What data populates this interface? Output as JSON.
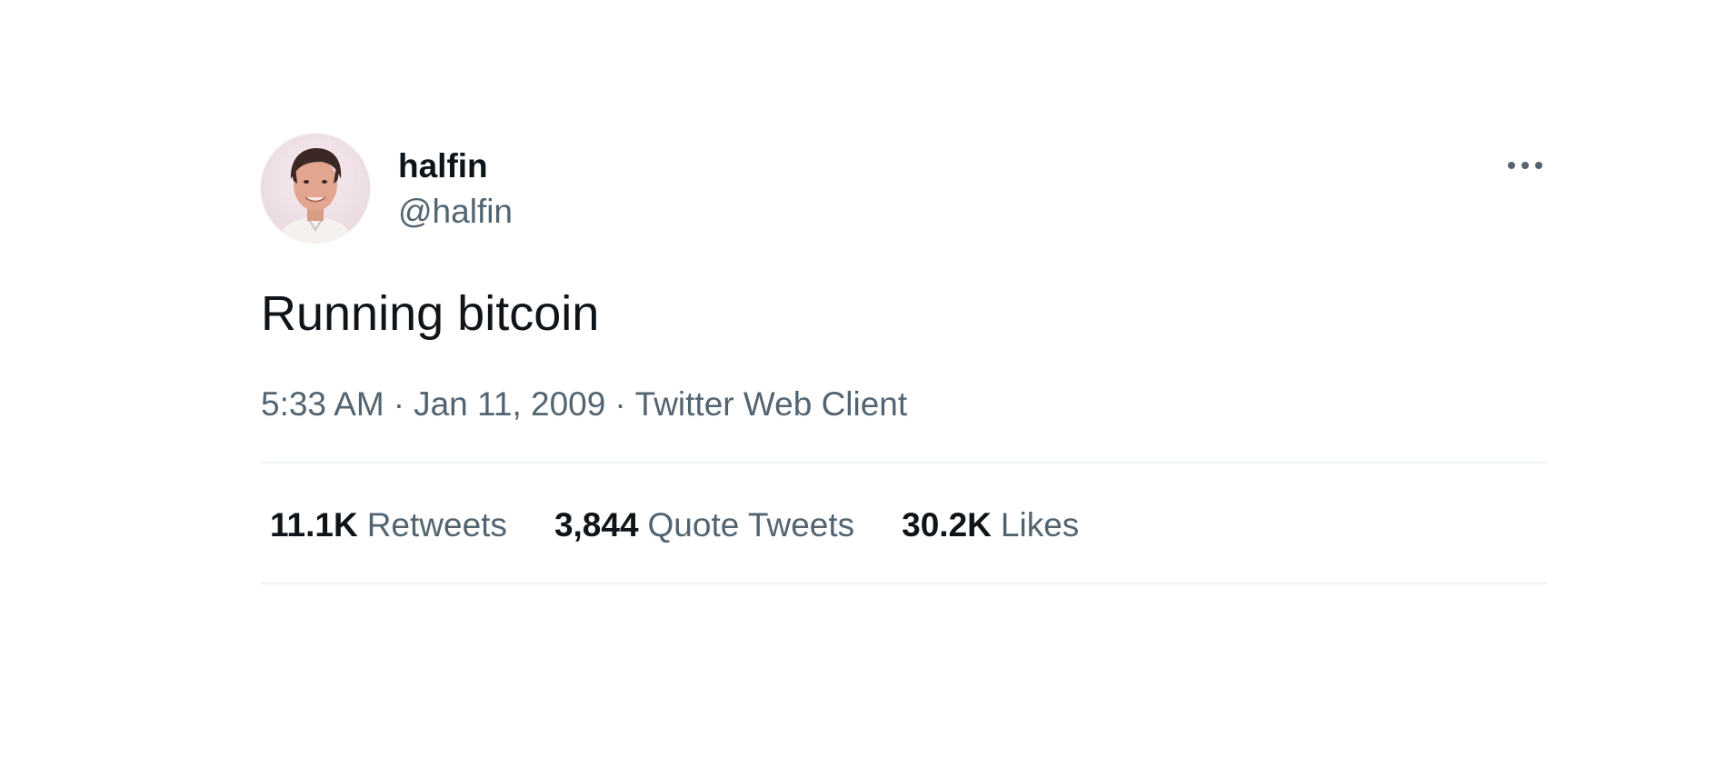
{
  "header": {
    "display_name": "halfin",
    "handle": "@halfin",
    "avatar_icon": "profile-photo",
    "more_icon": "more-options-icon"
  },
  "tweet": {
    "text": "Running bitcoin",
    "time": "5:33 AM",
    "date": "Jan 11, 2009",
    "source": "Twitter Web Client",
    "separator": "·"
  },
  "stats": {
    "retweets": {
      "count": "11.1K",
      "label": "Retweets"
    },
    "quote_tweets": {
      "count": "3,844",
      "label": "Quote Tweets"
    },
    "likes": {
      "count": "30.2K",
      "label": "Likes"
    }
  },
  "colors": {
    "primary_text": "#0f1419",
    "secondary_text": "#536471",
    "divider": "#eff3f4",
    "background": "#ffffff"
  }
}
